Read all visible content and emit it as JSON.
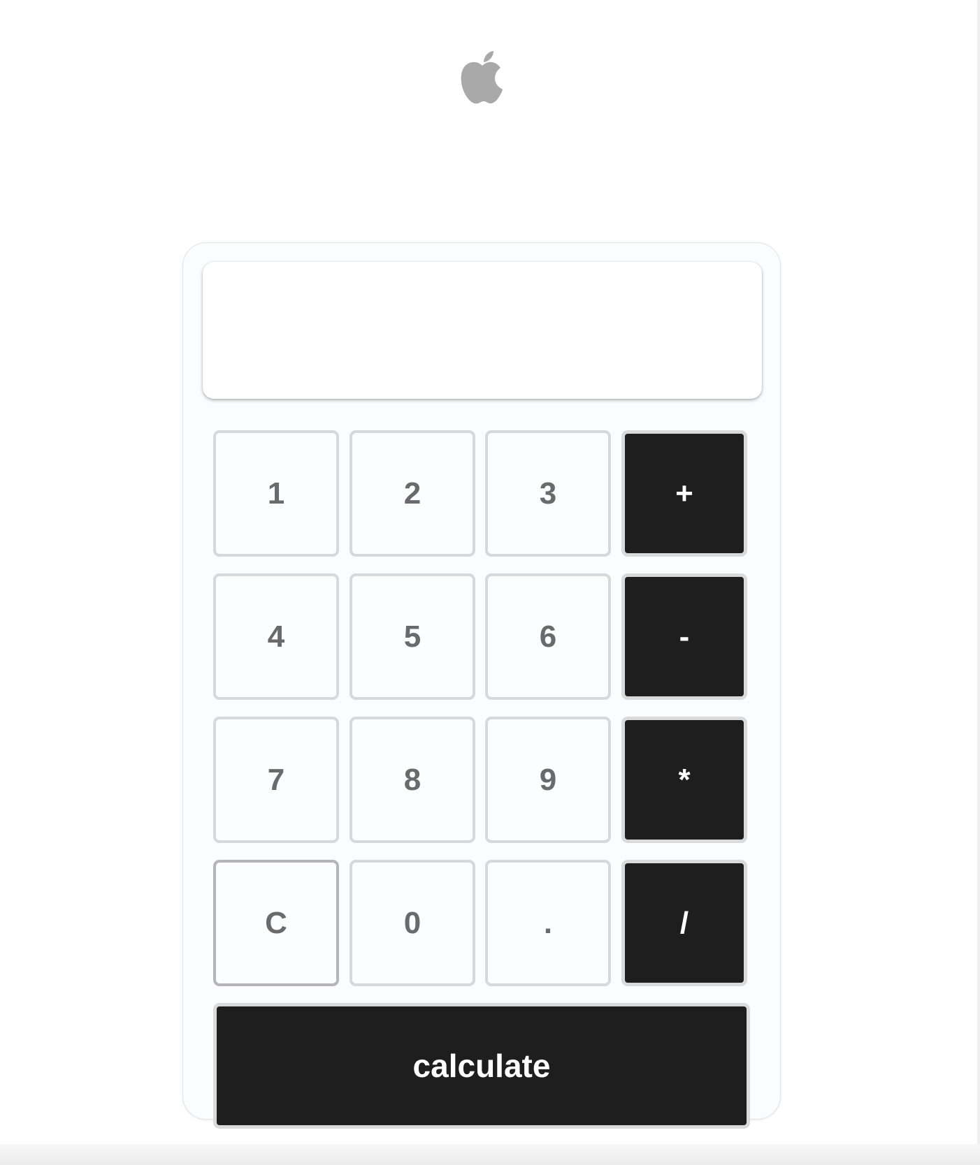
{
  "brand": {
    "logo_icon": "apple-logo-icon",
    "logo_color": "#a9a9a9"
  },
  "display": {
    "value": ""
  },
  "keys": {
    "row1": [
      "1",
      "2",
      "3",
      "+"
    ],
    "row2": [
      "4",
      "5",
      "6",
      "-"
    ],
    "row3": [
      "7",
      "8",
      "9",
      "*"
    ],
    "row4": [
      "C",
      "0",
      ".",
      "/"
    ]
  },
  "calculate_label": "calculate",
  "colors": {
    "operator_key": "#1e1e1e",
    "number_key_text": "#6a6a6a",
    "card_background": "#fbfcfd"
  }
}
